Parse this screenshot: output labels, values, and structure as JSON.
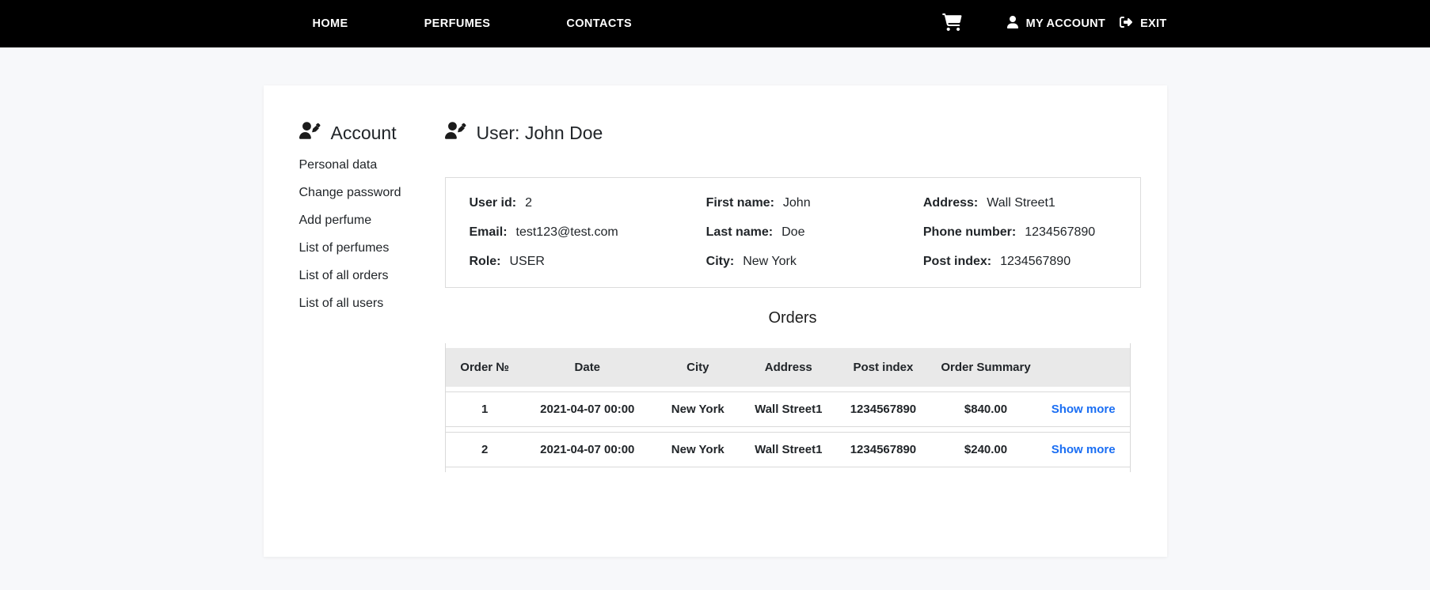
{
  "nav": {
    "links": [
      {
        "label": "HOME"
      },
      {
        "label": "PERFUMES"
      },
      {
        "label": "CONTACTS"
      }
    ],
    "cart_icon": "shopping-cart",
    "account_label": "MY ACCOUNT",
    "exit_label": "EXIT"
  },
  "sidebar": {
    "title": "Account",
    "items": [
      {
        "label": "Personal data"
      },
      {
        "label": "Change password"
      },
      {
        "label": "Add perfume"
      },
      {
        "label": "List of perfumes"
      },
      {
        "label": "List of all orders"
      },
      {
        "label": "List of all users"
      }
    ]
  },
  "main": {
    "title": "User: John Doe",
    "user_info": {
      "fields": [
        {
          "label": "User id:",
          "value": "2"
        },
        {
          "label": "Email:",
          "value": "test123@test.com"
        },
        {
          "label": "Role:",
          "value": "USER"
        },
        {
          "label": "First name:",
          "value": "John"
        },
        {
          "label": "Last name:",
          "value": "Doe"
        },
        {
          "label": "City:",
          "value": "New York"
        },
        {
          "label": "Address:",
          "value": "Wall Street1"
        },
        {
          "label": "Phone number:",
          "value": "1234567890"
        },
        {
          "label": "Post index:",
          "value": "1234567890"
        }
      ]
    },
    "orders": {
      "title": "Orders",
      "columns": [
        "Order №",
        "Date",
        "City",
        "Address",
        "Post index",
        "Order Summary"
      ],
      "rows": [
        {
          "order_no": "1",
          "date": "2021-04-07 00:00",
          "city": "New York",
          "address": "Wall Street1",
          "post_index": "1234567890",
          "summary": "$840.00",
          "action": "Show more"
        },
        {
          "order_no": "2",
          "date": "2021-04-07 00:00",
          "city": "New York",
          "address": "Wall Street1",
          "post_index": "1234567890",
          "summary": "$240.00",
          "action": "Show more"
        }
      ]
    }
  },
  "colors": {
    "nav_bg": "#000000",
    "page_bg": "#f7f8fa",
    "link_blue": "#1a6ef3",
    "table_header_bg": "#e9e9e9"
  }
}
